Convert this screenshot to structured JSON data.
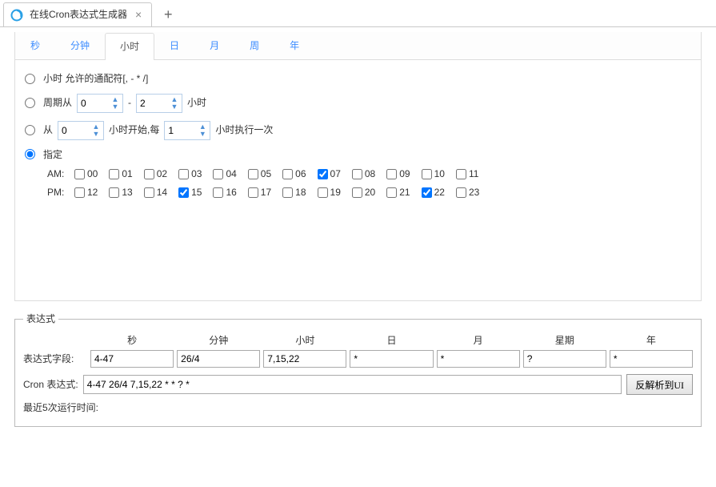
{
  "window": {
    "title": "在线Cron表达式生成器"
  },
  "tabs": {
    "items": [
      "秒",
      "分钟",
      "小时",
      "日",
      "月",
      "周",
      "年"
    ],
    "activeIndex": 2
  },
  "options": {
    "wildcard": {
      "selected": false,
      "label": "小时 允许的通配符[, - * /]"
    },
    "cycle": {
      "selected": false,
      "prefix": "周期从",
      "from": "0",
      "to": "2",
      "suffix": "小时",
      "sep": "-"
    },
    "fromEvery": {
      "selected": false,
      "l1": "从",
      "start": "0",
      "l2": "小时开始,每",
      "every": "1",
      "l3": "小时执行一次"
    },
    "specify": {
      "selected": true,
      "label": "指定",
      "amLabel": "AM:",
      "pmLabel": "PM:",
      "am": [
        {
          "n": "00",
          "c": false
        },
        {
          "n": "01",
          "c": false
        },
        {
          "n": "02",
          "c": false
        },
        {
          "n": "03",
          "c": false
        },
        {
          "n": "04",
          "c": false
        },
        {
          "n": "05",
          "c": false
        },
        {
          "n": "06",
          "c": false
        },
        {
          "n": "07",
          "c": true
        },
        {
          "n": "08",
          "c": false
        },
        {
          "n": "09",
          "c": false
        },
        {
          "n": "10",
          "c": false
        },
        {
          "n": "11",
          "c": false
        }
      ],
      "pm": [
        {
          "n": "12",
          "c": false
        },
        {
          "n": "13",
          "c": false
        },
        {
          "n": "14",
          "c": false
        },
        {
          "n": "15",
          "c": true
        },
        {
          "n": "16",
          "c": false
        },
        {
          "n": "17",
          "c": false
        },
        {
          "n": "18",
          "c": false
        },
        {
          "n": "19",
          "c": false
        },
        {
          "n": "20",
          "c": false
        },
        {
          "n": "21",
          "c": false
        },
        {
          "n": "22",
          "c": true
        },
        {
          "n": "23",
          "c": false
        }
      ]
    }
  },
  "expression": {
    "legend": "表达式",
    "headers": [
      "秒",
      "分钟",
      "小时",
      "日",
      "月",
      "星期",
      "年"
    ],
    "fieldLabel": "表达式字段:",
    "fields": {
      "sec": "4-47",
      "min": "26/4",
      "hour": "7,15,22",
      "day": "*",
      "month": "*",
      "week": "?",
      "year": "*"
    },
    "fullLabel": "Cron 表达式:",
    "full": "4-47 26/4 7,15,22 * * ? *",
    "parseBtn": "反解析到UI",
    "recentLabel": "最近5次运行时间:"
  }
}
